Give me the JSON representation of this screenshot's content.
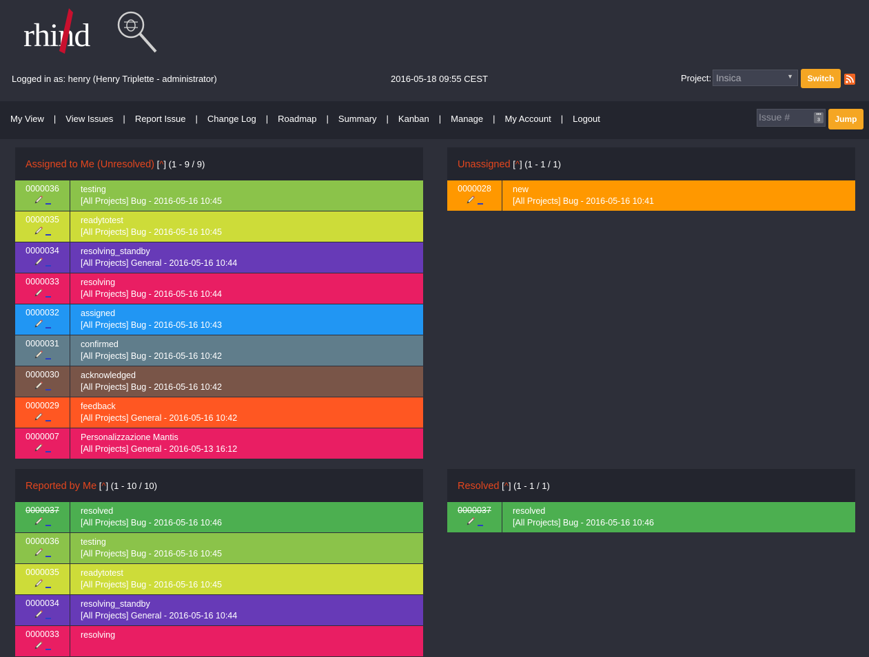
{
  "logo": {
    "text": "rhind"
  },
  "header": {
    "logged_in": "Logged in as: henry (Henry Triplette - administrator)",
    "datetime": "2016-05-18 09:55 CEST",
    "project_label": "Project:",
    "project_value": "Insica",
    "switch_label": "Switch"
  },
  "nav": {
    "links": [
      "My View",
      "View Issues",
      "Report Issue",
      "Change Log",
      "Roadmap",
      "Summary",
      "Kanban",
      "Manage",
      "My Account",
      "Logout"
    ],
    "separator": "|",
    "issue_placeholder": "Issue #",
    "jump_label": "Jump"
  },
  "panels": {
    "assigned": {
      "title": "Assigned to Me (Unresolved)",
      "bracket_open": "[",
      "caret": "^",
      "bracket_close": "]",
      "count": "(1 - 9 / 9)",
      "rows": [
        {
          "id": "0000036",
          "status": "testing",
          "detail": "[All Projects] Bug - 2016-05-16 10:45",
          "color": "#8bc34a",
          "resolved": false
        },
        {
          "id": "0000035",
          "status": "readytotest",
          "detail": "[All Projects] Bug - 2016-05-16 10:45",
          "color": "#cddc39",
          "resolved": false
        },
        {
          "id": "0000034",
          "status": "resolving_standby",
          "detail": "[All Projects] General - 2016-05-16 10:44",
          "color": "#673ab7",
          "resolved": false
        },
        {
          "id": "0000033",
          "status": "resolving",
          "detail": "[All Projects] Bug - 2016-05-16 10:44",
          "color": "#e91e63",
          "resolved": false
        },
        {
          "id": "0000032",
          "status": "assigned",
          "detail": "[All Projects] Bug - 2016-05-16 10:43",
          "color": "#2196f3",
          "resolved": false
        },
        {
          "id": "0000031",
          "status": "confirmed",
          "detail": "[All Projects] Bug - 2016-05-16 10:42",
          "color": "#607d8b",
          "resolved": false
        },
        {
          "id": "0000030",
          "status": "acknowledged",
          "detail": "[All Projects] Bug - 2016-05-16 10:42",
          "color": "#795548",
          "resolved": false
        },
        {
          "id": "0000029",
          "status": "feedback",
          "detail": "[All Projects] General - 2016-05-16 10:42",
          "color": "#ff5722",
          "resolved": false
        },
        {
          "id": "0000007",
          "status": "Personalizzazione Mantis",
          "detail": "[All Projects] General - 2016-05-13 16:12",
          "color": "#e91e63",
          "resolved": false
        }
      ]
    },
    "unassigned": {
      "title": "Unassigned",
      "bracket_open": "[",
      "caret": "^",
      "bracket_close": "]",
      "count": "(1 - 1 / 1)",
      "rows": [
        {
          "id": "0000028",
          "status": "new",
          "detail": "[All Projects] Bug - 2016-05-16 10:41",
          "color": "#ff9800",
          "resolved": false
        }
      ]
    },
    "reported": {
      "title": "Reported by Me",
      "bracket_open": "[",
      "caret": "^",
      "bracket_close": "]",
      "count": "(1 - 10 / 10)",
      "rows": [
        {
          "id": "0000037",
          "status": "resolved",
          "detail": "[All Projects] Bug - 2016-05-16 10:46",
          "color": "#4caf50",
          "resolved": true
        },
        {
          "id": "0000036",
          "status": "testing",
          "detail": "[All Projects] Bug - 2016-05-16 10:45",
          "color": "#8bc34a",
          "resolved": false
        },
        {
          "id": "0000035",
          "status": "readytotest",
          "detail": "[All Projects] Bug - 2016-05-16 10:45",
          "color": "#cddc39",
          "resolved": false
        },
        {
          "id": "0000034",
          "status": "resolving_standby",
          "detail": "[All Projects] General - 2016-05-16 10:44",
          "color": "#673ab7",
          "resolved": false
        },
        {
          "id": "0000033",
          "status": "resolving",
          "detail": "",
          "color": "#e91e63",
          "resolved": false
        }
      ]
    },
    "resolved": {
      "title": "Resolved",
      "bracket_open": "[",
      "caret": "^",
      "bracket_close": "]",
      "count": "(1 - 1 / 1)",
      "rows": [
        {
          "id": "0000037",
          "status": "resolved",
          "detail": "[All Projects] Bug - 2016-05-16 10:46",
          "color": "#4caf50",
          "resolved": true
        }
      ]
    }
  }
}
